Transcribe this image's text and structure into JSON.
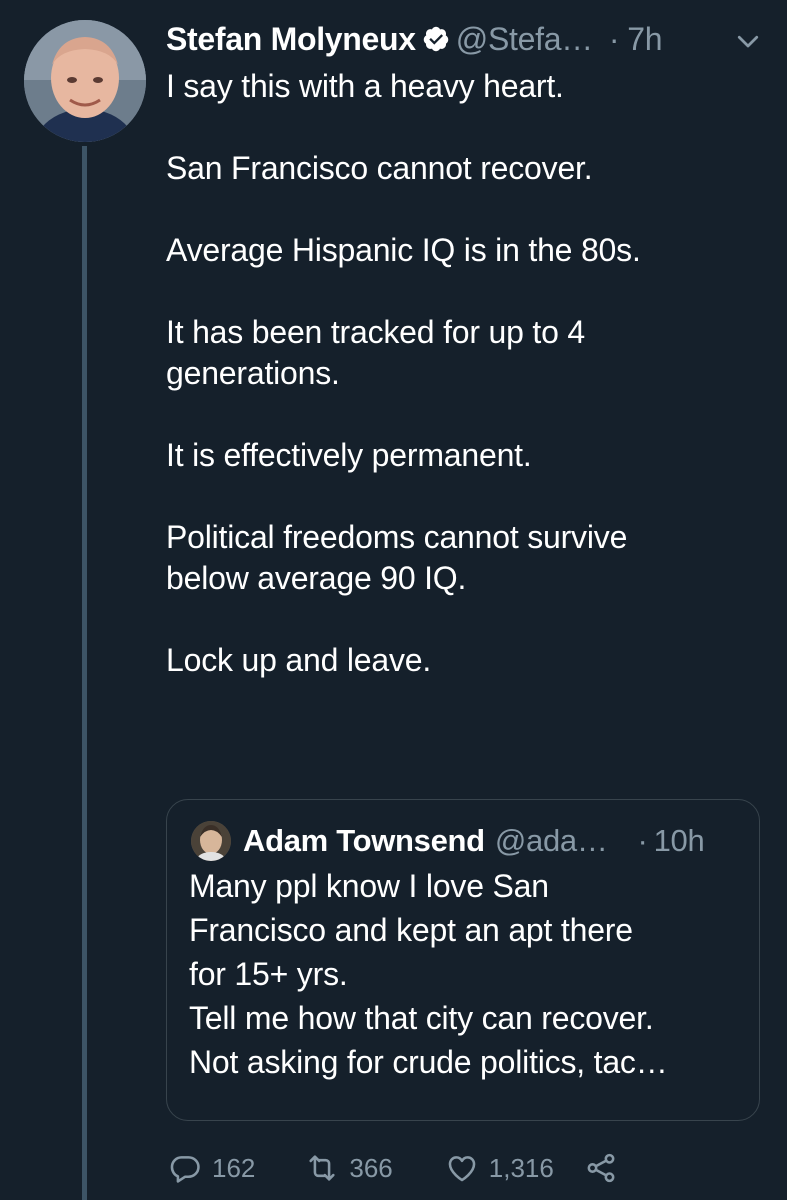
{
  "tweet": {
    "author_name": "Stefan Molyneux",
    "handle": "@Stefa…",
    "time": "7h",
    "lines": [
      "I say this with a heavy heart.",
      "",
      "San Francisco cannot recover.",
      "",
      "Average Hispanic IQ is in the 80s.",
      "",
      "It has been tracked for up to 4",
      "generations.",
      "",
      "It is effectively permanent.",
      "",
      "Political freedoms cannot survive",
      "below average 90 IQ.",
      "",
      "Lock up and leave."
    ]
  },
  "quote": {
    "author_name": "Adam Townsend",
    "handle": "@ada…",
    "time": "10h",
    "lines": [
      "Many ppl know I love San",
      "Francisco and kept an apt there",
      "for 15+ yrs.",
      "Tell me how that city can recover.",
      "Not asking for crude politics, tac…"
    ]
  },
  "actions": {
    "replies": "162",
    "retweets": "366",
    "likes": "1,316"
  },
  "icons": {
    "verified": "verified-badge-icon",
    "caret": "chevron-down-icon",
    "reply": "reply-icon",
    "retweet": "retweet-icon",
    "like": "heart-icon",
    "share": "share-icon"
  },
  "colors": {
    "background": "#15202b",
    "secondary_text": "#8899a6",
    "thread_line": "#3d5466",
    "quote_border": "#38444d"
  }
}
